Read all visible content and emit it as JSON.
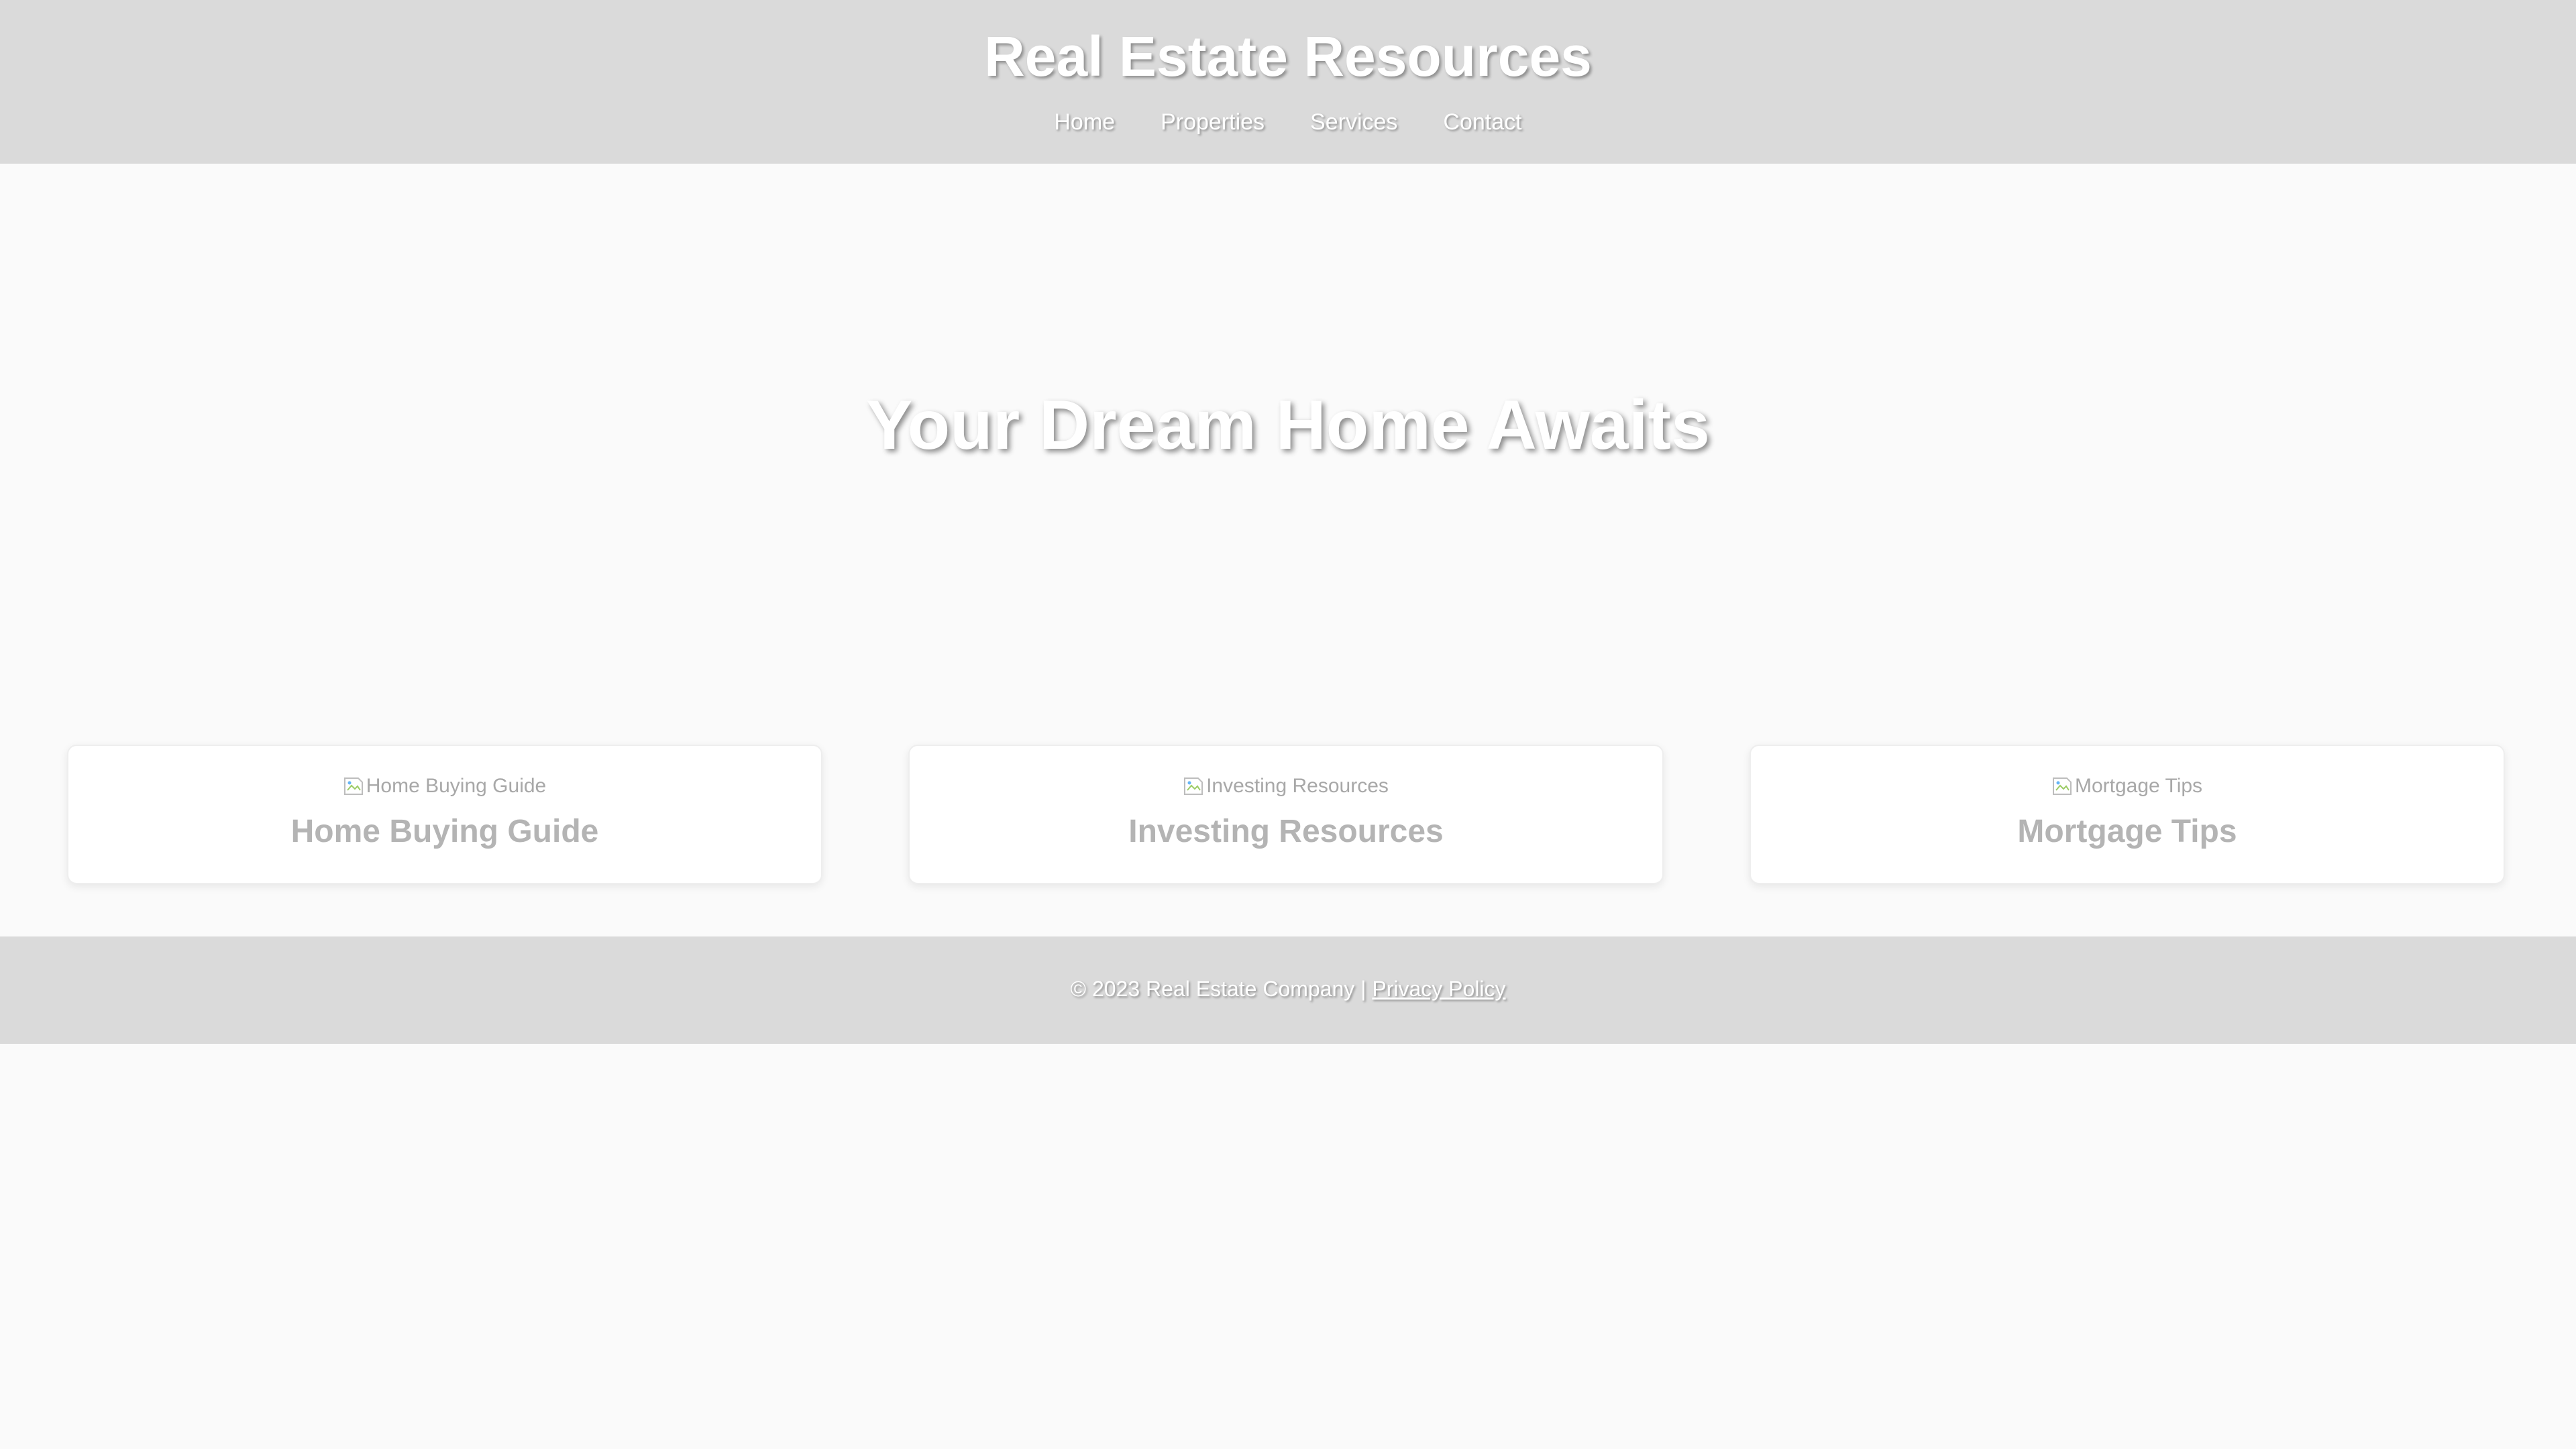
{
  "header": {
    "title": "Real Estate Resources",
    "nav": [
      {
        "label": "Home"
      },
      {
        "label": "Properties"
      },
      {
        "label": "Services"
      },
      {
        "label": "Contact"
      }
    ]
  },
  "hero": {
    "title": "Your Dream Home Awaits"
  },
  "cards": [
    {
      "image_alt": "Home Buying Guide",
      "title": "Home Buying Guide",
      "image_icon": "broken-image-icon"
    },
    {
      "image_alt": "Investing Resources",
      "title": "Investing Resources",
      "image_icon": "broken-image-icon"
    },
    {
      "image_alt": "Mortgage Tips",
      "title": "Mortgage Tips",
      "image_icon": "broken-image-icon"
    }
  ],
  "footer": {
    "copyright": "© 2023 Real Estate Company | ",
    "privacy_link": "Privacy Policy"
  },
  "colors": {
    "header_bg": "#dadada",
    "page_bg": "#fafafa",
    "card_title": "#b4b4b4"
  }
}
